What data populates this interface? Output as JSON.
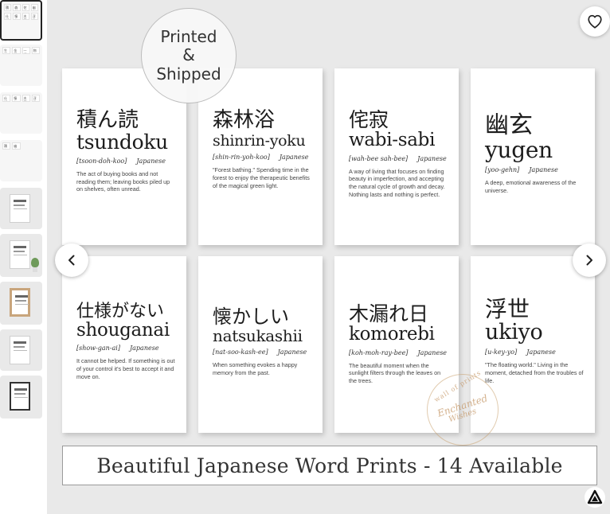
{
  "main_image": {
    "badge": {
      "line1": "Printed",
      "line2": "&",
      "line3": "Shipped"
    },
    "cards": [
      {
        "kanji": "積ん読",
        "romaji": "tsundoku",
        "pronunciation": "[tsoon-doh-koo]",
        "language": "Japanese",
        "definition": "The act of buying books and not reading them; leaving books piled up on shelves, often unread."
      },
      {
        "kanji": "森林浴",
        "romaji": "shinrin-yoku",
        "pronunciation": "[shin-rin-yoh-koo]",
        "language": "Japanese",
        "definition": "\"Forest bathing.\" Spending time in the forest to enjoy the therapeutic benefits of the magical green light."
      },
      {
        "kanji": "侘寂",
        "romaji": "wabi-sabi",
        "pronunciation": "[wah-bee sah-bee]",
        "language": "Japanese",
        "definition": "A way of living that focuses on finding beauty in imperfection, and accepting the natural cycle of growth and decay. Nothing lasts and nothing is perfect."
      },
      {
        "kanji": "幽玄",
        "romaji": "yugen",
        "pronunciation": "[yoo-gehn]",
        "language": "Japanese",
        "definition": "A deep, emotional awareness of the universe."
      },
      {
        "kanji": "仕様がない",
        "romaji": "shouganai",
        "pronunciation": "[show-gan-ai]",
        "language": "Japanese",
        "definition": "It cannot be helped. If something is out of your control it's best to accept it and move on."
      },
      {
        "kanji": "懐かしい",
        "romaji": "natsukashii",
        "pronunciation": "[nat-soo-kash-ee]",
        "language": "Japanese",
        "definition": "When something evokes a happy memory from the past."
      },
      {
        "kanji": "木漏れ日",
        "romaji": "komorebi",
        "pronunciation": "[koh-moh-ray-bee]",
        "language": "Japanese",
        "definition": "The beautiful moment when the sunlight filters through the leaves on the trees."
      },
      {
        "kanji": "浮世",
        "romaji": "ukiyo",
        "pronunciation": "[u-key-yo]",
        "language": "Japanese",
        "definition": "\"The floating world.\" Living in the moment, detached from the troubles of life."
      }
    ],
    "watermark": {
      "top": "wall of prints",
      "middle": "Enchanted",
      "bottom": "Wishes"
    },
    "banner": "Beautiful Japanese Word Prints - 14 Available"
  },
  "thumbnails": {
    "mini_words": [
      "積ん読",
      "森林浴",
      "侘寂",
      "幽玄",
      "仕様",
      "懐かし",
      "木漏れ",
      "浮世",
      "生き甲斐",
      "金継ぎ",
      "一期",
      "物の哀れ"
    ]
  },
  "icons": {
    "favorite": "heart-icon",
    "prev": "chevron-left-icon",
    "next": "chevron-right-icon",
    "logo": "brand-logo-icon"
  },
  "colors": {
    "background": "#e9e9e9",
    "card": "#ffffff",
    "text": "#1c1c1c",
    "watermark": "#c49664"
  }
}
